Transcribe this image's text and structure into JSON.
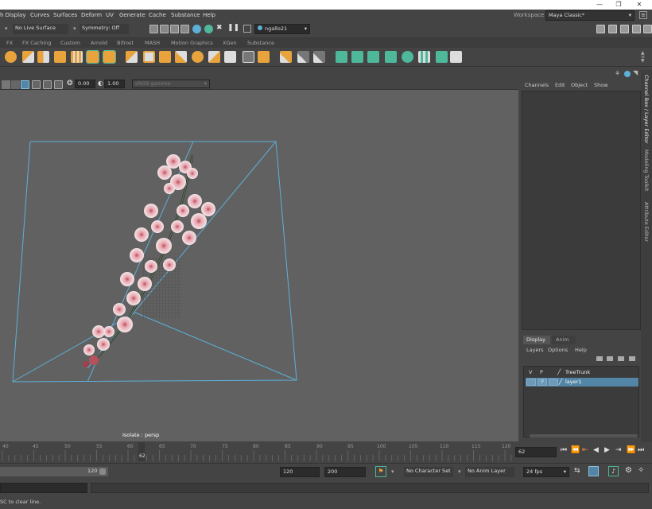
{
  "menubar": {
    "items": [
      "h Display",
      "Curves",
      "Surfaces",
      "Deform",
      "UV",
      "Generate",
      "Cache",
      "Substance",
      "Help"
    ],
    "workspace_label": "Workspace :",
    "workspace_value": "Maya Classic*"
  },
  "status_line": {
    "live_surface": "No Live Surface",
    "symmetry": "Symmetry: Off",
    "user": "ngallo21"
  },
  "shelf_tabs": [
    "FX",
    "FX Caching",
    "Custom",
    "Arnold",
    "Bifrost",
    "MASH",
    "Motion Graphics",
    "XGen",
    "Substance"
  ],
  "panel_toolbar": {
    "value1": "0.00",
    "value2": "1.00",
    "color_space": "sRGB gamma"
  },
  "viewport": {
    "isolate_label": "Isolate : persp"
  },
  "channel_box": {
    "menus": [
      "Channels",
      "Edit",
      "Object",
      "Show"
    ],
    "side_tabs": [
      "Channel Box / Layer Editor",
      "Modeling Toolkit",
      "Attribute Editor"
    ]
  },
  "layer_editor": {
    "tabs": [
      "Display",
      "Anim"
    ],
    "menus": [
      "Layers",
      "Options",
      "Help"
    ],
    "layers": [
      {
        "v": "V",
        "p": "P",
        "name": "TreeTrunk",
        "selected": false
      },
      {
        "v": "",
        "p": "P",
        "name": "layer1",
        "selected": true
      }
    ]
  },
  "timeline": {
    "ticks": [
      "40",
      "45",
      "50",
      "55",
      "60",
      "65",
      "70",
      "75",
      "80",
      "85",
      "90",
      "95",
      "100",
      "105",
      "110",
      "115",
      "120"
    ],
    "current_frame_marker": "62",
    "current_frame": "62"
  },
  "range": {
    "range_end_inner": "120",
    "end_time": "120",
    "end_range": "200",
    "character_set": "No Character Set",
    "anim_layer": "No Anim Layer",
    "fps": "24 fps"
  },
  "help_line": "SC to clear line.",
  "colors": {
    "accent_blue": "#5db0d7",
    "selected_layer": "#5285a6",
    "shelf_orange": "#e8a33c",
    "shelf_teal": "#4fb79a"
  }
}
